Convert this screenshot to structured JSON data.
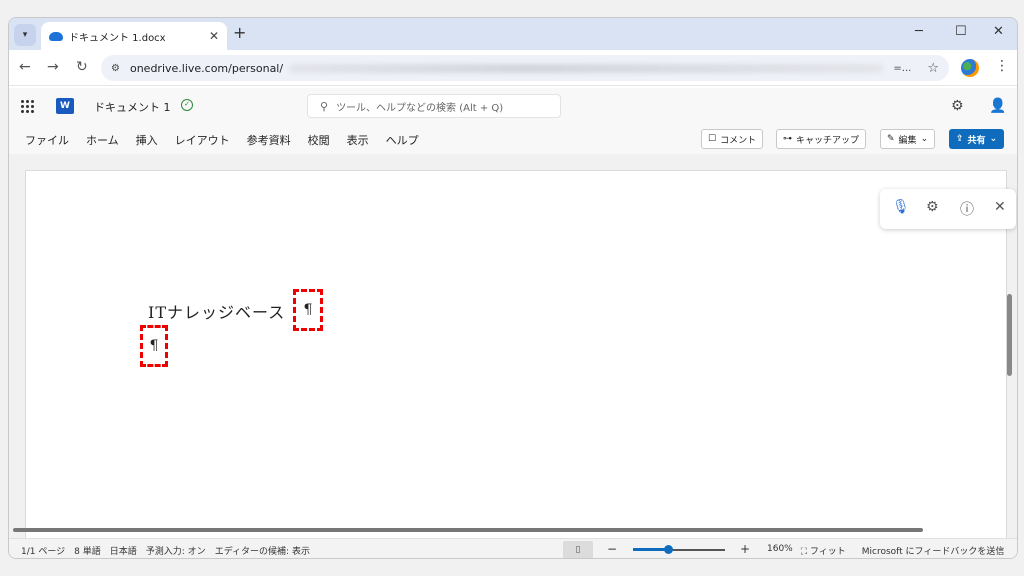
{
  "browser": {
    "tab_title": "ドキュメント 1.docx",
    "url": "onedrive.live.com/personal/",
    "ext_label": "=...",
    "icons": [
      "tab-search-icon",
      "cloud-icon",
      "close-icon",
      "plus-icon",
      "minimize-icon",
      "maximize-icon",
      "close-window-icon",
      "back-icon",
      "forward-icon",
      "reload-icon",
      "site-settings-icon",
      "star-icon",
      "profile-icon",
      "kebab-icon"
    ]
  },
  "word": {
    "doc_name": "ドキュメント 1",
    "search_placeholder": "ツール、ヘルプなどの検索 (Alt + Q)",
    "menu": [
      "ファイル",
      "ホーム",
      "挿入",
      "レイアウト",
      "参考資料",
      "校閲",
      "表示",
      "ヘルプ"
    ],
    "buttons": {
      "comment": "コメント",
      "catchup": "キャッチアップ",
      "edit": "編集",
      "share": "共有"
    },
    "document": {
      "line1": "ITナレッジベース",
      "pilcrow": "¶"
    }
  },
  "status": {
    "page": "1/1 ページ",
    "words": "8 単語",
    "language": "日本語",
    "prediction": "予測入力: オン",
    "editor": "エディターの候補: 表示",
    "zoom": "160%",
    "zoom_level": 0.38,
    "fit": "フィット",
    "feedback": "Microsoft にフィードバックを送信"
  },
  "colors": {
    "accent": "#0f6cbd",
    "highlight": "#ee0000",
    "word_brand": "#185abd"
  }
}
